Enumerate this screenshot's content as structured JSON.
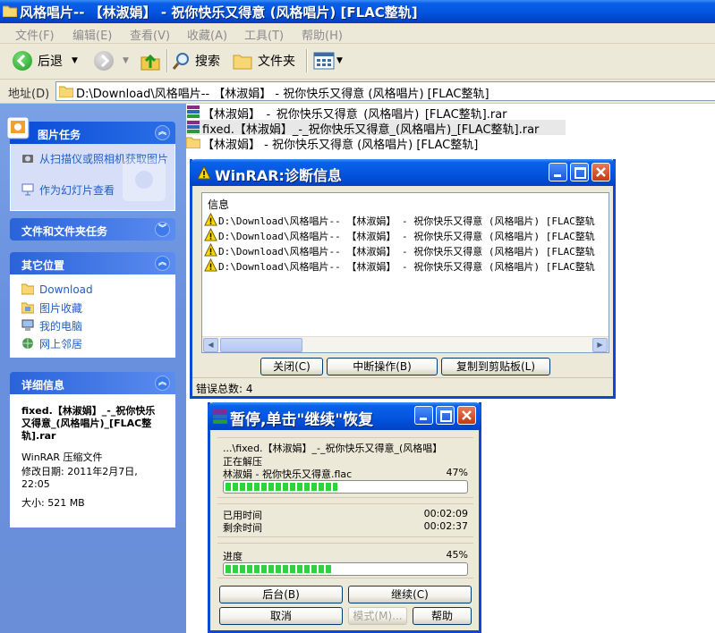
{
  "explorer": {
    "title": "风格唱片-- 【林淑娟】 - 祝你快乐又得意 (风格唱片) [FLAC整轨]",
    "menu": [
      "文件(F)",
      "编辑(E)",
      "查看(V)",
      "收藏(A)",
      "工具(T)",
      "帮助(H)"
    ],
    "toolbar": {
      "back": "后退",
      "search": "搜索",
      "folders": "文件夹"
    },
    "address_label": "地址(D)",
    "address": "D:\\Download\\风格唱片-- 【林淑娟】 - 祝你快乐又得意 (风格唱片) [FLAC整轨]"
  },
  "taskpane": {
    "picture_tasks": {
      "title": "图片任务",
      "links": [
        "从扫描仪或照相机获取图片",
        "作为幻灯片查看"
      ]
    },
    "file_tasks": {
      "title": "文件和文件夹任务"
    },
    "other_places": {
      "title": "其它位置",
      "links": [
        "Download",
        "图片收藏",
        "我的电脑",
        "网上邻居"
      ]
    },
    "details": {
      "title": "详细信息",
      "name": "fixed.【林淑娟】_-_祝你快乐又得意_(风格唱片)_[FLAC整轨].rar",
      "type": "WinRAR 压缩文件",
      "modified": "修改日期: 2011年2月7日, 22:05",
      "size": "大小: 521 MB"
    }
  },
  "files": [
    "【林淑娟】_-_祝你快乐又得意_(风格唱片)_[FLAC整轨].rar",
    "fixed.【林淑娟】_-_祝你快乐又得意_(风格唱片)_[FLAC整轨].rar",
    "【林淑娟】 - 祝你快乐又得意 (风格唱片) [FLAC整轨]"
  ],
  "diag": {
    "title": "WinRAR:诊断信息",
    "header": "信息",
    "rows": [
      "D:\\Download\\风格唱片--  【林淑娟】 - 祝你快乐又得意 (风格唱片) [FLAC整轨",
      "D:\\Download\\风格唱片--  【林淑娟】 - 祝你快乐又得意 (风格唱片) [FLAC整轨",
      "D:\\Download\\风格唱片--  【林淑娟】 - 祝你快乐又得意 (风格唱片) [FLAC整轨",
      "D:\\Download\\风格唱片--  【林淑娟】 - 祝你快乐又得意 (风格唱片) [FLAC整轨"
    ],
    "buttons": {
      "close": "关闭(C)",
      "abort": "中断操作(B)",
      "copy": "复制到剪贴板(L)"
    },
    "status": "错误总数: 4"
  },
  "progress": {
    "title": "暂停,单击\"继续\"恢复",
    "archive": "...\\fixed.【林淑娟】_-_祝你快乐又得意_(风格唱】",
    "action": "正在解压",
    "file": "林淑娟 - 祝你快乐又得意.flac",
    "file_percent": "47%",
    "file_fraction": 0.47,
    "elapsed_label": "已用时间",
    "elapsed": "00:02:09",
    "remaining_label": "剩余时间",
    "remaining": "00:02:37",
    "progress_label": "进度",
    "total_percent": "45%",
    "total_fraction": 0.45,
    "buttons": {
      "background": "后台(B)",
      "continue": "继续(C)",
      "cancel": "取消",
      "mode": "模式(M)...",
      "help": "帮助"
    }
  }
}
